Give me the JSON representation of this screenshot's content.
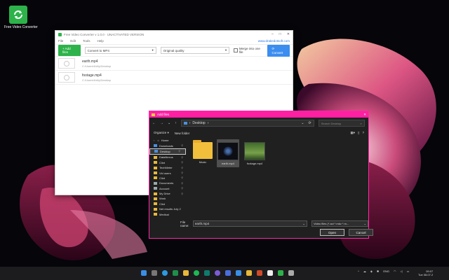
{
  "desktop": {
    "icon_label": "Free Video Converter",
    "icon_name": "refresh-arrows-icon"
  },
  "converter": {
    "title": "Free Video Converter v 1.0.0 · UNACTIVATED VERSION",
    "menu": [
      "File",
      "Edit",
      "Tools",
      "Help"
    ],
    "site_link": "www.drakedotsoft.com",
    "add_files_label": "+  Add files",
    "convert_to_value": "Convert to MP4",
    "quality_value": "Original quality",
    "merge_label": "Merge into one file",
    "convert_button_label": "Convert",
    "files": [
      {
        "name": "earth.mp4",
        "path": "C:\\Users\\Kelly\\Desktop"
      },
      {
        "name": "footage.mp4",
        "path": "C:\\Users\\Kelly\\Desktop"
      }
    ]
  },
  "dialog": {
    "title": "Add files",
    "address": "Desktop",
    "search_placeholder": "Search Desktop",
    "organize_label": "Organize ▾",
    "new_folder_label": "New folder",
    "nav_items": [
      {
        "label": "Home",
        "type": "home",
        "pinned": false
      },
      {
        "label": "Downloads",
        "type": "blue",
        "pinned": true
      },
      {
        "label": "Desktop",
        "type": "blue",
        "pinned": true,
        "selected": true
      },
      {
        "label": "DataNexus",
        "type": "yellow",
        "pinned": true
      },
      {
        "label": "Clint",
        "type": "yellow",
        "pinned": true
      },
      {
        "label": "TechMeter",
        "type": "yellow",
        "pinned": true
      },
      {
        "label": "Vid users",
        "type": "yellow",
        "pinned": true
      },
      {
        "label": "Clint",
        "type": "yellow",
        "pinned": true
      },
      {
        "label": "Documents",
        "type": "gray",
        "pinned": true
      },
      {
        "label": "Account",
        "type": "gray",
        "pinned": true
      },
      {
        "label": "My Drive",
        "type": "yellow",
        "pinned": true
      },
      {
        "label": "Work",
        "type": "yellow",
        "pinned": false
      },
      {
        "label": "Clint",
        "type": "yellow",
        "pinned": false
      },
      {
        "label": "Net results July 2",
        "type": "yellow",
        "pinned": false
      },
      {
        "label": "Medical",
        "type": "yellow",
        "pinned": false
      }
    ],
    "items": [
      {
        "label": "Music",
        "kind": "folder"
      },
      {
        "label": "earth.mp4",
        "kind": "video-dark",
        "selected": true
      },
      {
        "label": "footage.mp4",
        "kind": "video-green"
      }
    ],
    "file_name_label": "File name:",
    "file_name_value": "earth.mp4",
    "file_type_value": "Video files (*.avi *.mkv *.m...",
    "open_label": "Open",
    "cancel_label": "Cancel"
  },
  "taskbar": {
    "tray_text": "ENG",
    "time": "09:07",
    "date": "Tue 08.07.2"
  },
  "colors": {
    "brand_green": "#2db34a",
    "accent_blue": "#3b8df0",
    "dialog_accent": "#ff1fa2",
    "taskbar_bg": "#1c1c1e"
  }
}
